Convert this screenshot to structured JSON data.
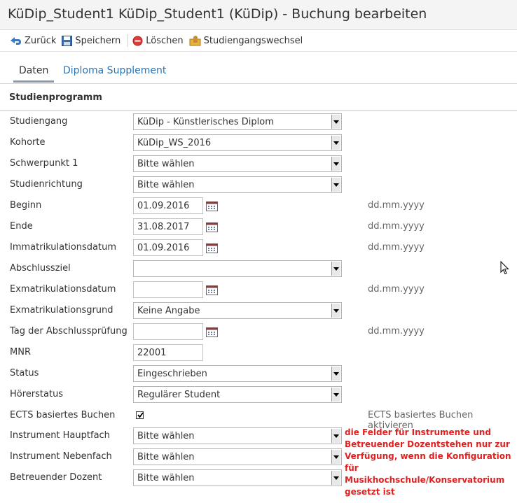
{
  "window": {
    "title": "KüDip_Student1 KüDip_Student1 (KüDip) - Buchung bearbeiten"
  },
  "toolbar": {
    "back_label": "Zurück",
    "save_label": "Speichern",
    "delete_label": "Löschen",
    "change_label": "Studiengangswechsel"
  },
  "tabs": [
    {
      "label": "Daten"
    },
    {
      "label": "Diploma Supplement"
    }
  ],
  "section": {
    "title": "Studienprogramm"
  },
  "date_hint": "dd.mm.yyyy",
  "fields": {
    "studiengang": {
      "label": "Studiengang",
      "value": "KüDip - Künstlerisches Diplom"
    },
    "kohorte": {
      "label": "Kohorte",
      "value": "KüDip_WS_2016"
    },
    "schwerpunkt": {
      "label": "Schwerpunkt 1",
      "value": "Bitte wählen"
    },
    "richtung": {
      "label": "Studienrichtung",
      "value": "Bitte wählen"
    },
    "beginn": {
      "label": "Beginn",
      "value": "01.09.2016"
    },
    "ende": {
      "label": "Ende",
      "value": "31.08.2017"
    },
    "immatrikulation": {
      "label": "Immatrikulationsdatum",
      "value": "01.09.2016"
    },
    "abschlussziel": {
      "label": "Abschlussziel",
      "value": ""
    },
    "exmatrikulation": {
      "label": "Exmatrikulationsdatum",
      "value": ""
    },
    "exgrund": {
      "label": "Exmatrikulationsgrund",
      "value": "Keine Angabe"
    },
    "pruefung": {
      "label": "Tag der Abschlussprüfung",
      "value": ""
    },
    "mnr": {
      "label": "MNR",
      "value": "22001"
    },
    "status": {
      "label": "Status",
      "value": "Eingeschrieben"
    },
    "hoererstatus": {
      "label": "Hörerstatus",
      "value": "Regulärer Student"
    },
    "ects": {
      "label": "ECTS basiertes Buchen",
      "checked": true,
      "hint": "ECTS basiertes Buchen aktivieren"
    },
    "hauptfach": {
      "label": "Instrument Hauptfach",
      "value": "Bitte wählen"
    },
    "nebenfach": {
      "label": "Instrument Nebenfach",
      "value": "Bitte wählen"
    },
    "dozent": {
      "label": "Betreuender Dozent",
      "value": "Bitte wählen"
    }
  },
  "annotation": {
    "lines": [
      "die Felder für Instrumente und",
      "Betreuender Dozentstehen nur zur",
      "Verfügung, wenn die Konfiguration",
      "für Musikhochschule/Konservatorium",
      "gesetzt ist"
    ],
    "color": "#e32020"
  }
}
